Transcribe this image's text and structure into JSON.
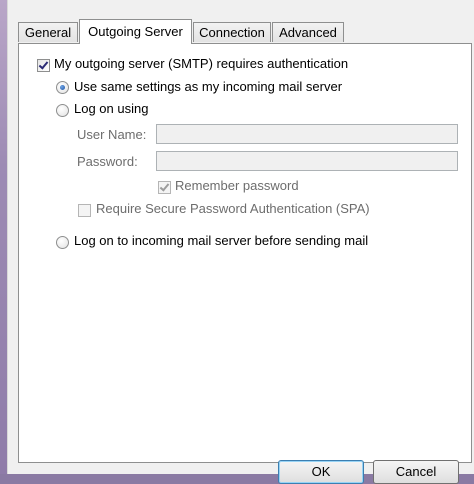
{
  "tabs": [
    {
      "label": "General",
      "active": false
    },
    {
      "label": "Outgoing Server",
      "active": true
    },
    {
      "label": "Connection",
      "active": false
    },
    {
      "label": "Advanced",
      "active": false
    }
  ],
  "smtp_auth": {
    "label": "My outgoing server (SMTP) requires authentication",
    "checked": true
  },
  "use_same": {
    "label": "Use same settings as my incoming mail server",
    "selected": true
  },
  "log_on_using": {
    "label": "Log on using",
    "selected": false
  },
  "user_name": {
    "label": "User Name:",
    "value": ""
  },
  "password": {
    "label": "Password:",
    "value": ""
  },
  "remember_password": {
    "label": "Remember password",
    "checked": true
  },
  "spa": {
    "label": "Require Secure Password Authentication (SPA)",
    "checked": false
  },
  "log_on_incoming": {
    "label": "Log on to incoming mail server before sending mail",
    "selected": false
  },
  "buttons": {
    "ok": "OK",
    "cancel": "Cancel"
  }
}
